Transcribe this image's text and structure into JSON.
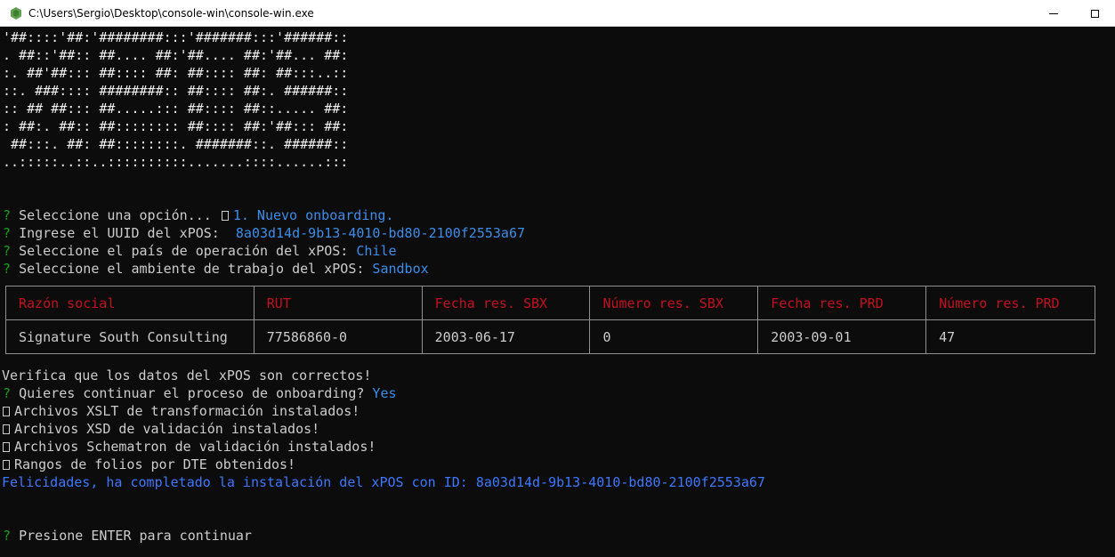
{
  "window": {
    "title": "C:\\Users\\Sergio\\Desktop\\console-win\\console-win.exe",
    "icon": "nodejs-icon",
    "buttons": {
      "minimize": "minimize-icon",
      "maximize": "maximize-icon"
    }
  },
  "banner": [
    "'##::::'##:'########:::'#######:::'######::",
    ". ##::'##:: ##.... ##:'##.... ##:'##... ##:",
    ":. ##'##::: ##:::: ##: ##:::: ##: ##:::..::",
    "::. ###:::: ########:: ##:::: ##:. ######::",
    ":: ## ##::: ##.....::: ##:::: ##::..... ##:",
    ": ##:. ##:: ##:::::::: ##:::: ##:'##::: ##:",
    " ##:::. ##: ##::::::::. #######::. ######::",
    "..:::::..::..::::::::::.......::::......:::"
  ],
  "prompts": {
    "mark": "?",
    "option_label": "Seleccione una opción...",
    "option_value": "1. Nuevo onboarding.",
    "uuid_label": "Ingrese el UUID del xPOS:",
    "uuid_value": "8a03d14d-9b13-4010-bd80-2100f2553a67",
    "country_label": "Seleccione el país de operación del xPOS:",
    "country_value": "Chile",
    "env_label": "Seleccione el ambiente de trabajo del xPOS:",
    "env_value": "Sandbox"
  },
  "table": {
    "headers": [
      "Razón social",
      "RUT",
      "Fecha res. SBX",
      "Número res. SBX",
      "Fecha res. PRD",
      "Número res. PRD"
    ],
    "rows": [
      [
        "Signature South Consulting",
        "77586860-0",
        "2003-06-17",
        "0",
        "2003-09-01",
        "47"
      ]
    ]
  },
  "after": {
    "verify": "Verifica que los datos del xPOS son correctos!",
    "continue_label": "Quieres continuar el proceso de onboarding?",
    "continue_value": "Yes",
    "installed": [
      "Archivos XSLT de transformación instalados!",
      "Archivos XSD de validación instalados!",
      "Archivos Schematron de validación instalados!",
      "Rangos de folios por DTE obtenidos!"
    ],
    "success": "Felicidades, ha completado la instalación del xPOS con ID: 8a03d14d-9b13-4010-bd80-2100f2553a67",
    "enter": "Presione ENTER para continuar"
  },
  "colors": {
    "background": "#0c0c0c",
    "prompt_mark": "#13a10e",
    "answer": "#3b8eea",
    "header_text": "#c50f1f",
    "ascii": "#f0f0f0",
    "text": "#cccccc"
  }
}
